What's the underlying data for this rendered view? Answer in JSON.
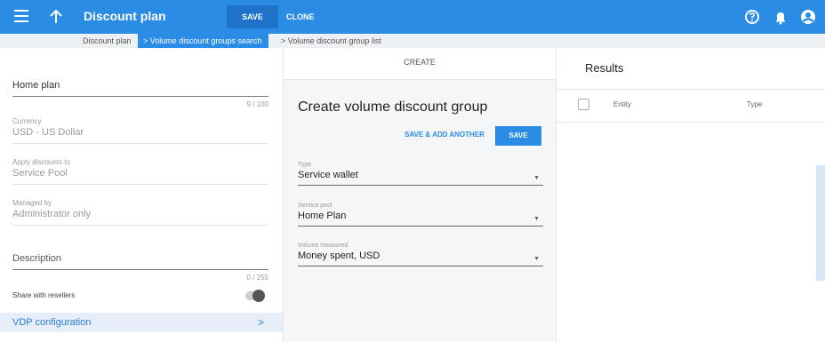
{
  "topbar": {
    "title": "Discount plan",
    "save_label": "SAVE",
    "clone_label": "CLONE",
    "icons": [
      "menu-icon",
      "arrow-up-icon",
      "help-icon",
      "bell-icon",
      "account-icon"
    ],
    "color": "#2b8ce6"
  },
  "breadcrumb": {
    "items": [
      "Discount plan",
      "Volume discount groups search",
      "Volume discount group list"
    ],
    "separator": ">"
  },
  "left": {
    "name": {
      "value": "Home plan",
      "counter": "9 / 100"
    },
    "currency": {
      "label": "Currency",
      "value": "USD - US Dollar"
    },
    "apply": {
      "label": "Apply discounts to",
      "value": "Service Pool"
    },
    "managed": {
      "label": "Managed by",
      "value": "Administrator only"
    },
    "description": {
      "placeholder": "Description",
      "counter": "0 / 255"
    },
    "share": {
      "label": "Share with resellers",
      "enabled": false
    },
    "vdp": {
      "label": "VDP configuration",
      "chevron": ">"
    }
  },
  "middle": {
    "header": "CREATE",
    "title": "Create volume discount group",
    "save_add_label": "SAVE & ADD ANOTHER",
    "save_label": "SAVE",
    "type": {
      "label": "Type",
      "value": "Service wallet"
    },
    "pool": {
      "label": "Service pool",
      "value": "Home Plan"
    },
    "volume": {
      "label": "Volume measured",
      "value": "Money spent, USD"
    }
  },
  "right": {
    "title": "Results",
    "columns": [
      "Entity",
      "Type"
    ]
  }
}
